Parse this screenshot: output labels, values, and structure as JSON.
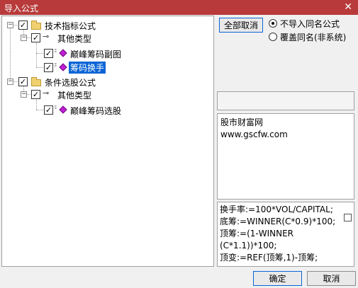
{
  "window": {
    "title": "导入公式",
    "close_glyph": "✕"
  },
  "tree": {
    "groups": [
      {
        "label": "技术指标公式",
        "subgroup": "其他类型",
        "items": [
          "巅峰筹码副图",
          "筹码换手"
        ],
        "selected_item": "筹码换手"
      },
      {
        "label": "条件选股公式",
        "subgroup": "其他类型",
        "items": [
          "巅峰筹码选股"
        ]
      }
    ],
    "check_glyph": "✓",
    "collapse_glyph": "−"
  },
  "options": {
    "cancel_all_label": "全部取消",
    "radio_no_import": "不导入同名公式",
    "radio_overwrite": "覆盖同名(非系统)",
    "selected_radio": "no_import"
  },
  "info": {
    "line1": "股市财富网",
    "line2": "www.gscfw.com"
  },
  "formula": {
    "lines": [
      "换手率:=100*VOL/CAPITAL;",
      "底筹:=WINNER(C*0.9)*100;",
      "顶筹:=(1-WINNER",
      "(C*1.1))*100;",
      "顶变:=REF(顶筹,1)-顶筹;"
    ]
  },
  "footer": {
    "ok_label": "确定",
    "cancel_label": "取消"
  }
}
